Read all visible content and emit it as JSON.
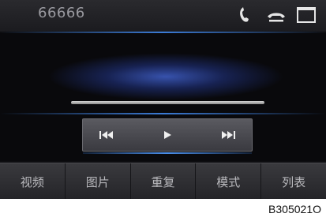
{
  "header": {
    "title": "66666",
    "icons": [
      "phone-handset-icon",
      "hang-up-icon",
      "window-icon"
    ]
  },
  "controls": {
    "icons": [
      "previous-track-icon",
      "play-icon",
      "next-track-icon"
    ]
  },
  "menu": {
    "items": [
      {
        "label": "视频"
      },
      {
        "label": "图片"
      },
      {
        "label": "重复"
      },
      {
        "label": "模式"
      },
      {
        "label": "列表"
      }
    ]
  },
  "figure_code": "B305021O",
  "colors": {
    "accent_blue": "#3b7bd6",
    "background": "#0d0d10",
    "menu_text": "#b8b8bc"
  }
}
